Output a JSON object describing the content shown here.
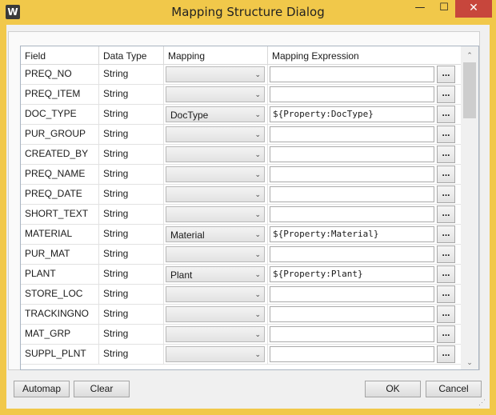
{
  "window": {
    "title": "Mapping Structure Dialog",
    "app_icon_letter": "W",
    "minimize_glyph": "—",
    "maximize_glyph": "☐",
    "close_glyph": "✕"
  },
  "grid": {
    "columns": [
      "Field",
      "Data Type",
      "Mapping",
      "Mapping Expression"
    ],
    "browse_label": "...",
    "rows": [
      {
        "field": "PREQ_NO",
        "type": "String",
        "mapping": "",
        "expression": ""
      },
      {
        "field": "PREQ_ITEM",
        "type": "String",
        "mapping": "",
        "expression": ""
      },
      {
        "field": "DOC_TYPE",
        "type": "String",
        "mapping": "DocType",
        "expression": "${Property:DocType}"
      },
      {
        "field": "PUR_GROUP",
        "type": "String",
        "mapping": "",
        "expression": ""
      },
      {
        "field": "CREATED_BY",
        "type": "String",
        "mapping": "",
        "expression": ""
      },
      {
        "field": "PREQ_NAME",
        "type": "String",
        "mapping": "",
        "expression": ""
      },
      {
        "field": "PREQ_DATE",
        "type": "String",
        "mapping": "",
        "expression": ""
      },
      {
        "field": "SHORT_TEXT",
        "type": "String",
        "mapping": "",
        "expression": ""
      },
      {
        "field": "MATERIAL",
        "type": "String",
        "mapping": "Material",
        "expression": "${Property:Material}"
      },
      {
        "field": "PUR_MAT",
        "type": "String",
        "mapping": "",
        "expression": ""
      },
      {
        "field": "PLANT",
        "type": "String",
        "mapping": "Plant",
        "expression": "${Property:Plant}"
      },
      {
        "field": "STORE_LOC",
        "type": "String",
        "mapping": "",
        "expression": ""
      },
      {
        "field": "TRACKINGNO",
        "type": "String",
        "mapping": "",
        "expression": ""
      },
      {
        "field": "MAT_GRP",
        "type": "String",
        "mapping": "",
        "expression": ""
      },
      {
        "field": "SUPPL_PLNT",
        "type": "String",
        "mapping": "",
        "expression": ""
      }
    ]
  },
  "buttons": {
    "automap": "Automap",
    "clear": "Clear",
    "ok": "OK",
    "cancel": "Cancel"
  },
  "icons": {
    "scroll_up": "⌃",
    "scroll_down": "⌄",
    "combo_arrow": "⌄",
    "resize_grip": "⋰"
  }
}
